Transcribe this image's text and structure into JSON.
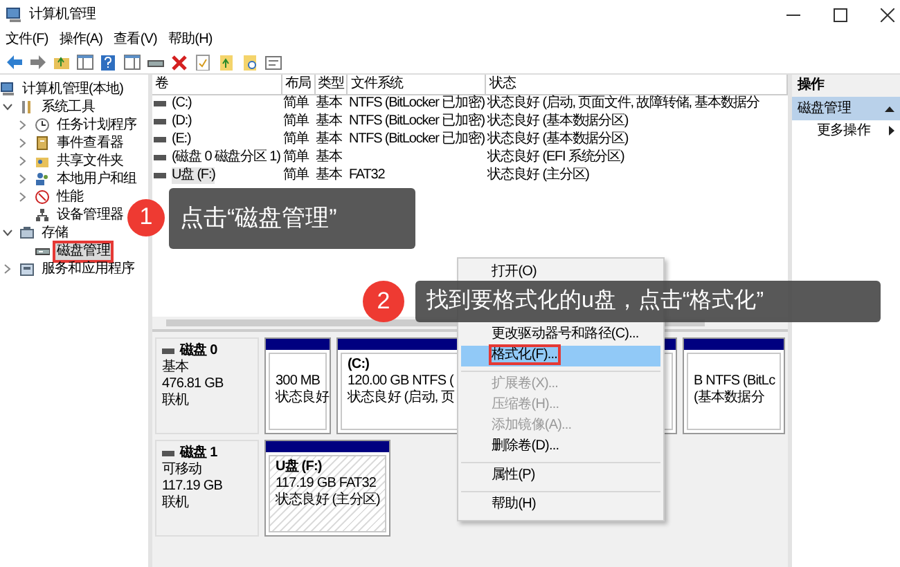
{
  "window": {
    "title": "计算机管理"
  },
  "menu_bar": [
    "文件(F)",
    "操作(A)",
    "查看(V)",
    "帮助(H)"
  ],
  "tree": [
    {
      "label": "计算机管理(本地)",
      "selected": false,
      "outlined": false,
      "children": [
        {
          "label": "系统工具",
          "expanded": true,
          "selected": false,
          "outlined": false,
          "children": [
            {
              "label": "任务计划程序",
              "expanded": false,
              "selected": false,
              "outlined": false
            },
            {
              "label": "事件查看器",
              "expanded": false,
              "selected": false,
              "outlined": false
            },
            {
              "label": "共享文件夹",
              "expanded": false,
              "selected": false,
              "outlined": false
            },
            {
              "label": "本地用户和组",
              "expanded": false,
              "selected": false,
              "outlined": false
            },
            {
              "label": "性能",
              "expanded": false,
              "selected": false,
              "outlined": false
            },
            {
              "label": "设备管理器",
              "selected": false,
              "outlined": false
            }
          ]
        },
        {
          "label": "存储",
          "expanded": true,
          "selected": false,
          "outlined": false,
          "children": [
            {
              "label": "磁盘管理",
              "selected": true,
              "outlined": true
            }
          ]
        },
        {
          "label": "服务和应用程序",
          "expanded": false,
          "selected": false,
          "outlined": false
        }
      ]
    }
  ],
  "volume_list": {
    "columns": [
      "卷",
      "布局",
      "类型",
      "文件系统",
      "状态"
    ],
    "rows": [
      {
        "cells": [
          "(C:)",
          "简单",
          "基本",
          "NTFS (BitLocker 已加密)",
          "状态良好 (启动, 页面文件, 故障转储, 基本数据分"
        ],
        "selected": false
      },
      {
        "cells": [
          "(D:)",
          "简单",
          "基本",
          "NTFS (BitLocker 已加密)",
          "状态良好 (基本数据分区)"
        ],
        "selected": false
      },
      {
        "cells": [
          "(E:)",
          "简单",
          "基本",
          "NTFS (BitLocker 已加密)",
          "状态良好 (基本数据分区)"
        ],
        "selected": false
      },
      {
        "cells": [
          "(磁盘 0 磁盘分区 1)",
          "简单",
          "基本",
          null,
          "状态良好 (EFI 系统分区)"
        ],
        "selected": false
      },
      {
        "cells": [
          "U盘 (F:)",
          "简单",
          "基本",
          "FAT32",
          "状态良好 (主分区)"
        ],
        "selected": true
      }
    ]
  },
  "disks": [
    {
      "name": "磁盘 0",
      "info": [
        "基本",
        "476.81 GB",
        "联机"
      ],
      "partitions": [
        {
          "lines": [
            "300 MB",
            "状态良好"
          ],
          "selected": false
        },
        {
          "title": "(C:)",
          "lines": [
            "120.00 GB NTFS (",
            "状态良好 (启动, 页"
          ],
          "selected": false
        },
        {
          "lines": [
            "B NTFS (BitLc",
            "(基本数据分"
          ],
          "selected": false
        }
      ]
    },
    {
      "name": "磁盘 1",
      "info": [
        "可移动",
        "117.19 GB",
        "联机"
      ],
      "partitions": [
        {
          "title": "U盘 (F:)",
          "lines": [
            "117.19 GB FAT32",
            "状态良好 (主分区)"
          ],
          "selected": true
        }
      ]
    }
  ],
  "actions": {
    "header": "操作",
    "sections": [
      {
        "title": "磁盘管理",
        "expanded": true,
        "items": [
          {
            "label": "更多操作",
            "submenu": true
          }
        ]
      }
    ]
  },
  "context_menu": [
    {
      "kind": "item",
      "label": "打开(O)",
      "disabled": false,
      "selected": false,
      "outlined": false
    },
    {
      "kind": "covered"
    },
    {
      "kind": "covered"
    },
    {
      "kind": "item",
      "label": "更改驱动器号和路径(C)...",
      "disabled": false,
      "selected": false,
      "outlined": false
    },
    {
      "kind": "item",
      "label": "格式化(F)...",
      "disabled": false,
      "selected": true,
      "outlined": true
    },
    {
      "kind": "separator"
    },
    {
      "kind": "item",
      "label": "扩展卷(X)...",
      "disabled": true,
      "selected": false,
      "outlined": false
    },
    {
      "kind": "item",
      "label": "压缩卷(H)...",
      "disabled": true,
      "selected": false,
      "outlined": false
    },
    {
      "kind": "item",
      "label": "添加镜像(A)...",
      "disabled": true,
      "selected": false,
      "outlined": false
    },
    {
      "kind": "item",
      "label": "删除卷(D)...",
      "disabled": false,
      "selected": false,
      "outlined": false
    },
    {
      "kind": "separator"
    },
    {
      "kind": "item",
      "label": "属性(P)",
      "disabled": false,
      "selected": false,
      "outlined": false
    },
    {
      "kind": "separator"
    },
    {
      "kind": "item",
      "label": "帮助(H)",
      "disabled": false,
      "selected": false,
      "outlined": false
    }
  ],
  "callouts": [
    {
      "number": "1",
      "text": "点击“磁盘管理”"
    },
    {
      "number": "2",
      "text": "找到要格式化的u盘，点击“格式化”"
    }
  ]
}
